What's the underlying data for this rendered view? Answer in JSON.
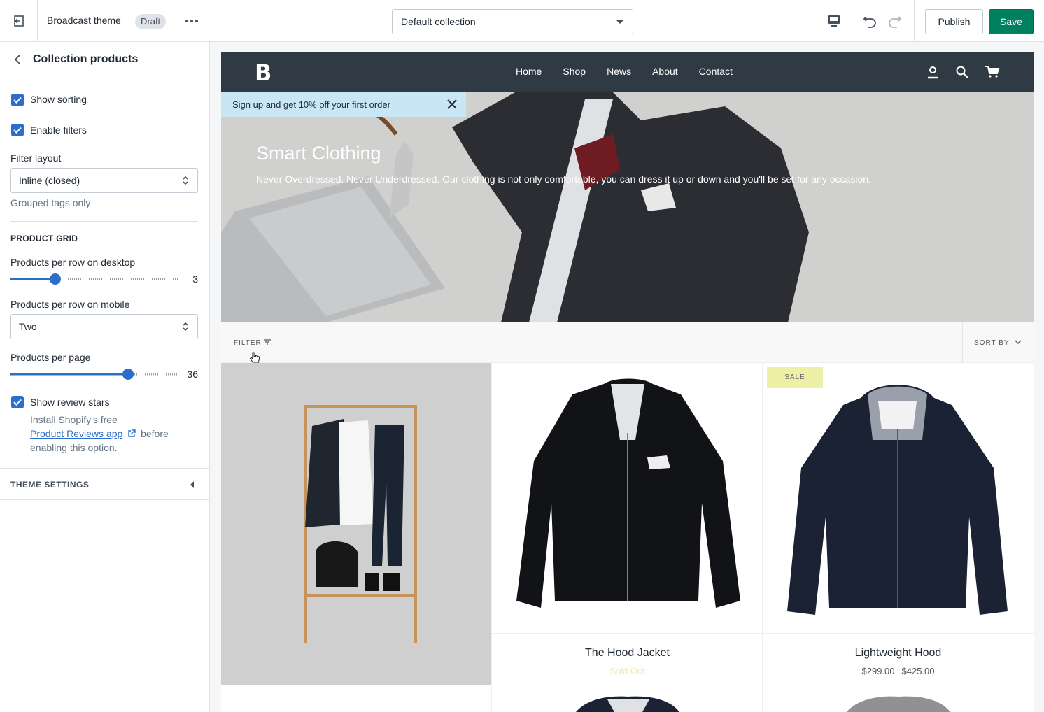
{
  "topbar": {
    "theme_name": "Broadcast theme",
    "status_badge": "Draft",
    "collection_select": "Default collection",
    "publish_label": "Publish",
    "save_label": "Save"
  },
  "sidebar": {
    "title": "Collection products",
    "show_sorting": "Show sorting",
    "enable_filters": "Enable filters",
    "filter_layout_label": "Filter layout",
    "filter_layout_value": "Inline (closed)",
    "filter_layout_help": "Grouped tags only",
    "product_grid_title": "PRODUCT GRID",
    "per_row_desktop_label": "Products per row on desktop",
    "per_row_desktop_value": "3",
    "per_row_mobile_label": "Products per row on mobile",
    "per_row_mobile_value": "Two",
    "per_page_label": "Products per page",
    "per_page_value": "36",
    "show_review_stars": "Show review stars",
    "review_help_before": "Install Shopify's free",
    "review_help_link": "Product Reviews app",
    "review_help_after": "before enabling this option.",
    "theme_settings": "THEME SETTINGS"
  },
  "store": {
    "logo": "B",
    "nav": [
      "Home",
      "Shop",
      "News",
      "About",
      "Contact"
    ],
    "promo_text": "Sign up and get 10% off your first order",
    "hero_title": "Smart Clothing",
    "hero_text": "Never Overdressed. Never Underdressed. Our clothing is not only comfortable, you can dress it up or down and you'll be set for any occasion.",
    "filter_label": "FILTER",
    "sort_label": "SORT BY",
    "products": [
      {
        "name": "The Hood Jacket",
        "price": "Sold Out"
      },
      {
        "name": "Lightweight Hood",
        "price": "$299.00",
        "compare_price": "$425.00",
        "badge": "SALE"
      }
    ]
  },
  "colors": {
    "accent": "#2c6ecb",
    "save_button": "#008060",
    "store_header": "#2f3a44",
    "promo_bar": "#c9e6f5",
    "sale_badge": "#eef0a8"
  }
}
